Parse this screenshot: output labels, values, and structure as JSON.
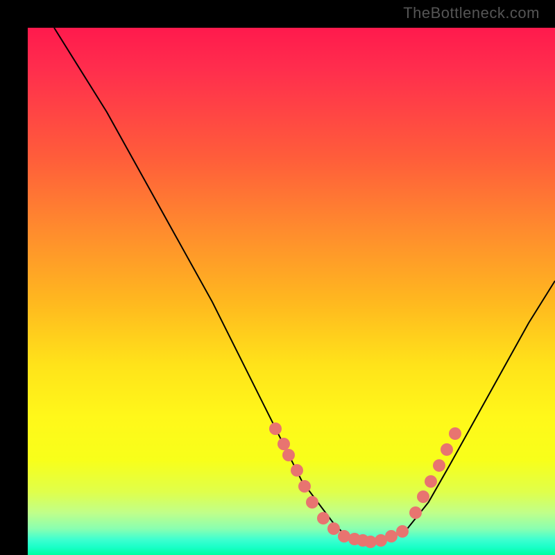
{
  "watermark": "TheBottleneck.com",
  "chart_data": {
    "type": "line",
    "title": "",
    "xlabel": "",
    "ylabel": "",
    "xlim": [
      0,
      100
    ],
    "ylim": [
      0,
      100
    ],
    "series": [
      {
        "name": "curve",
        "x": [
          5,
          10,
          15,
          20,
          25,
          30,
          35,
          40,
          45,
          48,
          50,
          52,
          55,
          58,
          60,
          62,
          65,
          68,
          72,
          76,
          80,
          85,
          90,
          95,
          100
        ],
        "y": [
          100,
          92,
          84,
          75,
          66,
          57,
          48,
          38,
          28,
          22,
          18,
          14,
          10,
          6,
          4,
          3,
          2.5,
          3,
          5,
          10,
          17,
          26,
          35,
          44,
          52
        ]
      }
    ],
    "points": [
      {
        "x": 47,
        "y": 24
      },
      {
        "x": 48.5,
        "y": 21
      },
      {
        "x": 49.5,
        "y": 19
      },
      {
        "x": 51,
        "y": 16
      },
      {
        "x": 52.5,
        "y": 13
      },
      {
        "x": 54,
        "y": 10
      },
      {
        "x": 56,
        "y": 7
      },
      {
        "x": 58,
        "y": 5
      },
      {
        "x": 60,
        "y": 3.5
      },
      {
        "x": 62,
        "y": 3
      },
      {
        "x": 63.5,
        "y": 2.7
      },
      {
        "x": 65,
        "y": 2.5
      },
      {
        "x": 67,
        "y": 2.8
      },
      {
        "x": 69,
        "y": 3.5
      },
      {
        "x": 71,
        "y": 4.5
      },
      {
        "x": 73.5,
        "y": 8
      },
      {
        "x": 75,
        "y": 11
      },
      {
        "x": 76.5,
        "y": 14
      },
      {
        "x": 78,
        "y": 17
      },
      {
        "x": 79.5,
        "y": 20
      },
      {
        "x": 81,
        "y": 23
      }
    ],
    "colors": {
      "curve": "#000000",
      "points": "#e87470"
    }
  }
}
